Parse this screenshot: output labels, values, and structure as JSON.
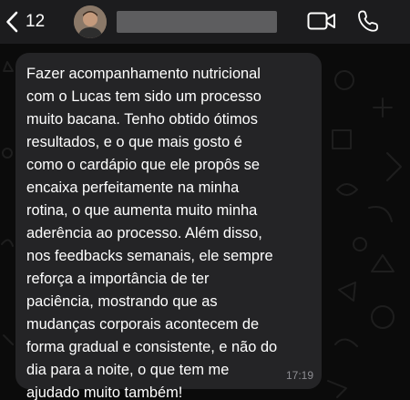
{
  "header": {
    "back_count": "12",
    "contact_name_redacted": true,
    "icons": [
      "chevron-left-icon",
      "video-camera-icon",
      "phone-icon"
    ]
  },
  "message": {
    "text": "Fazer acompanhamento nutricional\ncom o Lucas tem sido um processo\nmuito bacana. Tenho obtido ótimos\nresultados, e o que mais gosto é\ncomo o cardápio que ele propôs se\nencaixa perfeitamente na minha\nrotina, o que aumenta muito minha\naderência ao processo. Além disso,\nnos feedbacks semanais, ele sempre\nreforça a importância de ter\npaciência, mostrando que as\nmudanças corporais acontecem de\nforma gradual e consistente, e não do\ndia para a noite, o que tem me\najudado muito também!",
    "time": "17:19"
  },
  "colors": {
    "header_bg": "#1c1c1e",
    "chat_bg": "#0b0b0b",
    "bubble_bg": "#242426",
    "text": "#ffffff",
    "time": "#8e8e93"
  }
}
